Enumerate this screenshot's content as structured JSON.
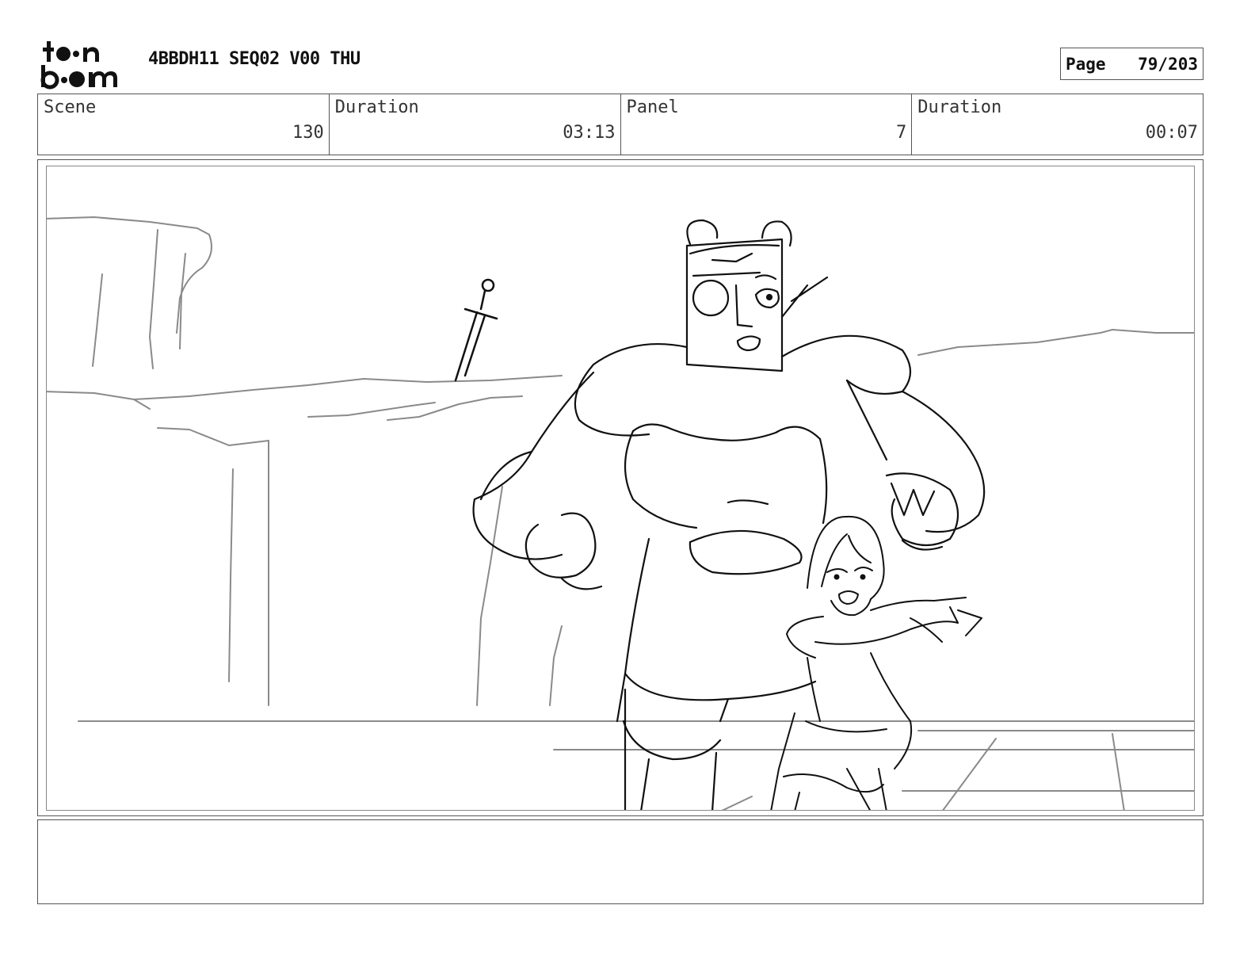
{
  "header": {
    "logo_line1": "toon",
    "logo_line2": "boom",
    "project_title": "4BBDH11 SEQ02 V00 THU",
    "page_label": "Page",
    "page_number": "79/203"
  },
  "info": {
    "scene_label": "Scene",
    "scene_value": "130",
    "scene_duration_label": "Duration",
    "scene_duration_value": "03:13",
    "panel_label": "Panel",
    "panel_value": "7",
    "panel_duration_label": "Duration",
    "panel_duration_value": "00:07"
  },
  "notes": {
    "text": ""
  }
}
